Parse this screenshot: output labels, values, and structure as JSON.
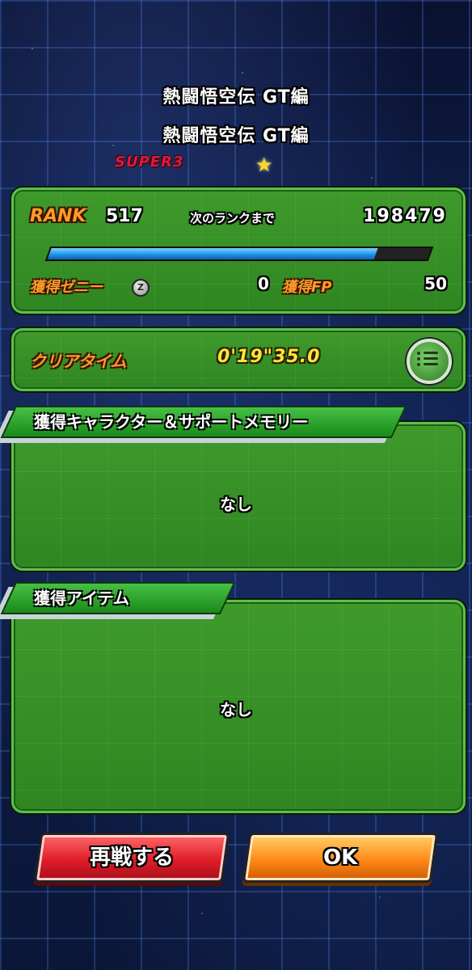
{
  "header": {
    "title1": "熱闘悟空伝 GT編",
    "title2": "熱闘悟空伝 GT編",
    "difficulty": "SUPER3"
  },
  "rank_panel": {
    "rank_label": "RANK",
    "rank_value": "517",
    "next_label": "次のランクまで",
    "next_value": "198479",
    "exp_progress": 0.86,
    "zeni_label": "獲得ゼニー",
    "zeni_value": "0",
    "fp_label": "獲得FP",
    "fp_value": "50"
  },
  "clear_panel": {
    "label": "クリアタイム",
    "time": "0'19\"35.0"
  },
  "characters_section": {
    "title": "獲得キャラクター＆サポートメモリー",
    "empty_text": "なし"
  },
  "items_section": {
    "title": "獲得アイテム",
    "empty_text": "なし"
  },
  "buttons": {
    "retry": "再戦する",
    "ok": "OK"
  },
  "colors": {
    "panel_green": "#3f9a2b",
    "rank_orange": "#ff9a2a",
    "value_yellow": "#ffe43a",
    "retry_red": "#e01e2a",
    "ok_orange": "#ff8a1a",
    "difficulty_red": "#e0193c",
    "exp_blue": "#1a8fe0"
  },
  "icons": [
    "star-icon",
    "zeni-coin-icon",
    "menu-list-icon"
  ]
}
